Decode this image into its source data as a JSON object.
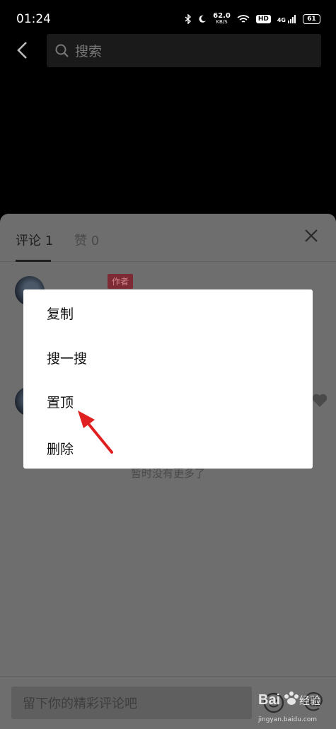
{
  "status_bar": {
    "time": "01:24",
    "net_speed": "62.0",
    "net_speed_unit": "KB/S",
    "hd": "HD",
    "signal": "4G",
    "battery": "61"
  },
  "search": {
    "placeholder": "搜索"
  },
  "sheet": {
    "tabs": [
      {
        "label": "评论 1"
      },
      {
        "label": "赞 0"
      }
    ],
    "author_badge": "作者",
    "no_more_text": "暂时没有更多了"
  },
  "comment_bar": {
    "placeholder": "留下你的精彩评论吧"
  },
  "context_menu": {
    "items": [
      {
        "label": "复制"
      },
      {
        "label": "搜一搜"
      },
      {
        "label": "置顶"
      },
      {
        "label": "删除"
      }
    ]
  },
  "watermark": {
    "brand": "Bai经验",
    "url": "jingyan.baidu.com"
  },
  "colors": {
    "accent_arrow": "#e02020",
    "author_badge_bg": "#7e2a35"
  }
}
